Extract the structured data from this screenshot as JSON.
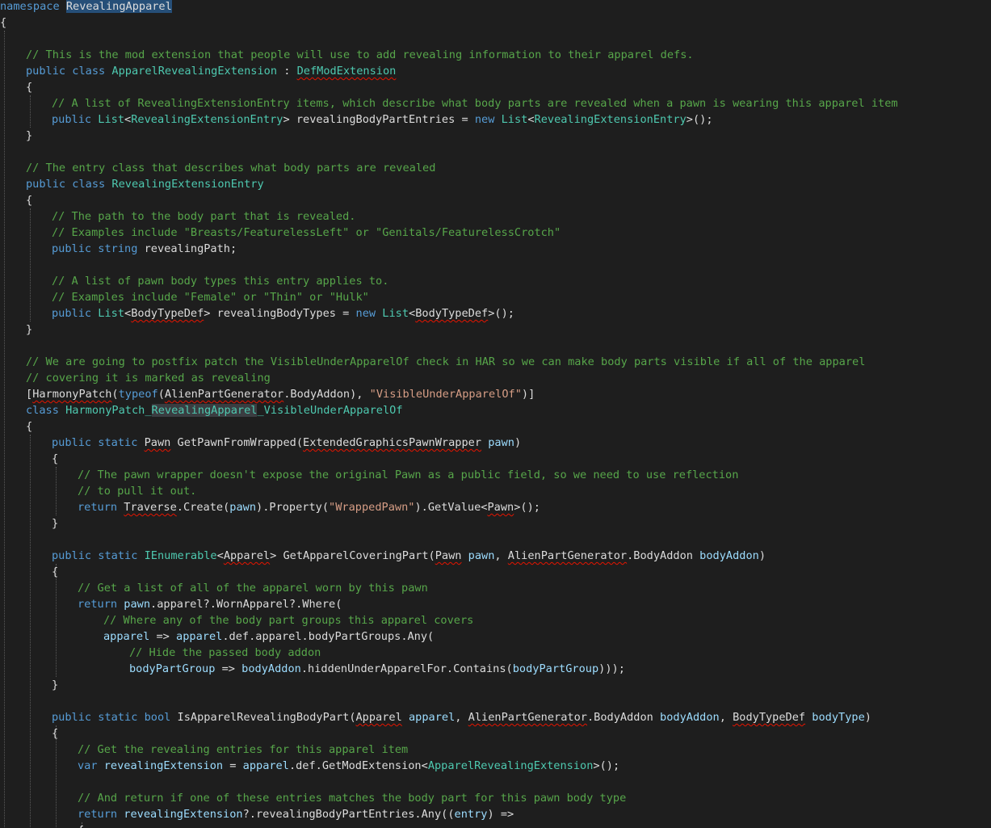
{
  "editor": {
    "file": "RevealingApparel",
    "colors": {
      "background": "#1e1e1e",
      "keyword": "#569cd6",
      "type": "#4ec9b0",
      "comment": "#57a64a",
      "string": "#d69d85",
      "parameter": "#9cdcfe",
      "plain": "#dcdcdc",
      "squiggle": "#e51400"
    },
    "lines": [
      [
        {
          "t": "namespace",
          "c": "kw"
        },
        {
          "t": " "
        },
        {
          "t": "RevealingApparel",
          "c": "pl hl"
        }
      ],
      [
        {
          "t": "{"
        }
      ],
      [],
      [
        {
          "t": "// This is the mod extension that people will use to add revealing information to their apparel defs.",
          "c": "cm"
        }
      ],
      [
        {
          "t": "public",
          "c": "kw"
        },
        {
          "t": " "
        },
        {
          "t": "class",
          "c": "kw"
        },
        {
          "t": " "
        },
        {
          "t": "ApparelRevealingExtension",
          "c": "ty"
        },
        {
          "t": " : "
        },
        {
          "t": "DefModExtension",
          "c": "ty sq"
        }
      ],
      [
        {
          "t": "{"
        }
      ],
      [
        {
          "t": "// A list of RevealingExtensionEntry items, which describe what body parts are revealed when a pawn is wearing this apparel item",
          "c": "cm"
        }
      ],
      [
        {
          "t": "public",
          "c": "kw"
        },
        {
          "t": " "
        },
        {
          "t": "List",
          "c": "ty"
        },
        {
          "t": "<"
        },
        {
          "t": "RevealingExtensionEntry",
          "c": "ty"
        },
        {
          "t": "> revealingBodyPartEntries = "
        },
        {
          "t": "new",
          "c": "kw"
        },
        {
          "t": " "
        },
        {
          "t": "List",
          "c": "ty"
        },
        {
          "t": "<"
        },
        {
          "t": "RevealingExtensionEntry",
          "c": "ty"
        },
        {
          "t": ">();"
        }
      ],
      [
        {
          "t": "}"
        }
      ],
      [],
      [
        {
          "t": "// The entry class that describes what body parts are revealed",
          "c": "cm"
        }
      ],
      [
        {
          "t": "public",
          "c": "kw"
        },
        {
          "t": " "
        },
        {
          "t": "class",
          "c": "kw"
        },
        {
          "t": " "
        },
        {
          "t": "RevealingExtensionEntry",
          "c": "ty"
        }
      ],
      [
        {
          "t": "{"
        }
      ],
      [
        {
          "t": "// The path to the body part that is revealed.",
          "c": "cm"
        }
      ],
      [
        {
          "t": "// Examples include \"Breasts/FeaturelessLeft\" or \"Genitals/FeaturelessCrotch\"",
          "c": "cm"
        }
      ],
      [
        {
          "t": "public",
          "c": "kw"
        },
        {
          "t": " "
        },
        {
          "t": "string",
          "c": "kw"
        },
        {
          "t": " revealingPath;"
        }
      ],
      [],
      [
        {
          "t": "// A list of pawn body types this entry applies to.",
          "c": "cm"
        }
      ],
      [
        {
          "t": "// Examples include \"Female\" or \"Thin\" or \"Hulk\"",
          "c": "cm"
        }
      ],
      [
        {
          "t": "public",
          "c": "kw"
        },
        {
          "t": " "
        },
        {
          "t": "List",
          "c": "ty"
        },
        {
          "t": "<"
        },
        {
          "t": "BodyTypeDef",
          "c": "pl sq"
        },
        {
          "t": "> revealingBodyTypes = "
        },
        {
          "t": "new",
          "c": "kw"
        },
        {
          "t": " "
        },
        {
          "t": "List",
          "c": "ty"
        },
        {
          "t": "<"
        },
        {
          "t": "BodyTypeDef",
          "c": "pl sq"
        },
        {
          "t": ">();"
        }
      ],
      [
        {
          "t": "}"
        }
      ],
      [],
      [
        {
          "t": "// We are going to postfix patch the VisibleUnderApparelOf check in HAR so we can make body parts visible if all of the apparel",
          "c": "cm"
        }
      ],
      [
        {
          "t": "// covering it is marked as revealing",
          "c": "cm"
        }
      ],
      [
        {
          "t": "["
        },
        {
          "t": "HarmonyPatch",
          "c": "pl sq"
        },
        {
          "t": "("
        },
        {
          "t": "typeof",
          "c": "kw"
        },
        {
          "t": "("
        },
        {
          "t": "AlienPartGenerator",
          "c": "pl sq"
        },
        {
          "t": "."
        },
        {
          "t": "BodyAddon",
          "c": "pl"
        },
        {
          "t": "), "
        },
        {
          "t": "\"VisibleUnderApparelOf\"",
          "c": "st"
        },
        {
          "t": ")]"
        }
      ],
      [
        {
          "t": "class",
          "c": "kw"
        },
        {
          "t": " "
        },
        {
          "t": "HarmonyPatch_",
          "c": "ty"
        },
        {
          "t": "RevealingApparel",
          "c": "ty hl2"
        },
        {
          "t": "_VisibleUnderApparelOf",
          "c": "ty"
        }
      ],
      [
        {
          "t": "{"
        }
      ],
      [
        {
          "t": "public",
          "c": "kw"
        },
        {
          "t": " "
        },
        {
          "t": "static",
          "c": "kw"
        },
        {
          "t": " "
        },
        {
          "t": "Pawn",
          "c": "pl sq"
        },
        {
          "t": " GetPawnFromWrapped("
        },
        {
          "t": "ExtendedGraphicsPawnWrapper",
          "c": "pl sq"
        },
        {
          "t": " "
        },
        {
          "t": "pawn",
          "c": "pa"
        },
        {
          "t": ")"
        }
      ],
      [
        {
          "t": "{"
        }
      ],
      [
        {
          "t": "// The pawn wrapper doesn't expose the original Pawn as a public field, so we need to use reflection",
          "c": "cm"
        }
      ],
      [
        {
          "t": "// to pull it out.",
          "c": "cm"
        }
      ],
      [
        {
          "t": "return",
          "c": "kw"
        },
        {
          "t": " "
        },
        {
          "t": "Traverse",
          "c": "pl sq"
        },
        {
          "t": ".Create("
        },
        {
          "t": "pawn",
          "c": "pa"
        },
        {
          "t": ").Property("
        },
        {
          "t": "\"WrappedPawn\"",
          "c": "st"
        },
        {
          "t": ").GetValue<"
        },
        {
          "t": "Pawn",
          "c": "pl sq"
        },
        {
          "t": ">();"
        }
      ],
      [
        {
          "t": "}"
        }
      ],
      [],
      [
        {
          "t": "public",
          "c": "kw"
        },
        {
          "t": " "
        },
        {
          "t": "static",
          "c": "kw"
        },
        {
          "t": " "
        },
        {
          "t": "IEnumerable",
          "c": "ty"
        },
        {
          "t": "<"
        },
        {
          "t": "Apparel",
          "c": "pl sq"
        },
        {
          "t": "> GetApparelCoveringPart("
        },
        {
          "t": "Pawn",
          "c": "pl sq"
        },
        {
          "t": " "
        },
        {
          "t": "pawn",
          "c": "pa"
        },
        {
          "t": ", "
        },
        {
          "t": "AlienPartGenerator",
          "c": "pl sq"
        },
        {
          "t": "."
        },
        {
          "t": "BodyAddon",
          "c": "pl"
        },
        {
          "t": " "
        },
        {
          "t": "bodyAddon",
          "c": "pa"
        },
        {
          "t": ")"
        }
      ],
      [
        {
          "t": "{"
        }
      ],
      [
        {
          "t": "// Get a list of all of the apparel worn by this pawn",
          "c": "cm"
        }
      ],
      [
        {
          "t": "return",
          "c": "kw"
        },
        {
          "t": " "
        },
        {
          "t": "pawn",
          "c": "pa"
        },
        {
          "t": ".apparel?.WornApparel?.Where("
        }
      ],
      [
        {
          "t": "// Where any of the body part groups this apparel covers",
          "c": "cm"
        }
      ],
      [
        {
          "t": "apparel",
          "c": "pa"
        },
        {
          "t": " => "
        },
        {
          "t": "apparel",
          "c": "pa"
        },
        {
          "t": ".def.apparel.bodyPartGroups.Any("
        }
      ],
      [
        {
          "t": "// Hide the passed body addon",
          "c": "cm"
        }
      ],
      [
        {
          "t": "bodyPartGroup",
          "c": "pa"
        },
        {
          "t": " => "
        },
        {
          "t": "bodyAddon",
          "c": "pa"
        },
        {
          "t": ".hiddenUnderApparelFor.Contains("
        },
        {
          "t": "bodyPartGroup",
          "c": "pa"
        },
        {
          "t": ")));"
        }
      ],
      [
        {
          "t": "}"
        }
      ],
      [],
      [
        {
          "t": "public",
          "c": "kw"
        },
        {
          "t": " "
        },
        {
          "t": "static",
          "c": "kw"
        },
        {
          "t": " "
        },
        {
          "t": "bool",
          "c": "kw"
        },
        {
          "t": " IsApparelRevealingBodyPart("
        },
        {
          "t": "Apparel",
          "c": "pl sq"
        },
        {
          "t": " "
        },
        {
          "t": "apparel",
          "c": "pa"
        },
        {
          "t": ", "
        },
        {
          "t": "AlienPartGenerator",
          "c": "pl sq"
        },
        {
          "t": "."
        },
        {
          "t": "BodyAddon",
          "c": "pl"
        },
        {
          "t": " "
        },
        {
          "t": "bodyAddon",
          "c": "pa"
        },
        {
          "t": ", "
        },
        {
          "t": "BodyTypeDef",
          "c": "pl sq"
        },
        {
          "t": " "
        },
        {
          "t": "bodyType",
          "c": "pa"
        },
        {
          "t": ")"
        }
      ],
      [
        {
          "t": "{"
        }
      ],
      [
        {
          "t": "// Get the revealing entries for this apparel item",
          "c": "cm"
        }
      ],
      [
        {
          "t": "var",
          "c": "kw"
        },
        {
          "t": " "
        },
        {
          "t": "revealingExtension",
          "c": "pa"
        },
        {
          "t": " = "
        },
        {
          "t": "apparel",
          "c": "pa"
        },
        {
          "t": ".def.GetModExtension<"
        },
        {
          "t": "ApparelRevealingExtension",
          "c": "ty"
        },
        {
          "t": ">();"
        }
      ],
      [],
      [
        {
          "t": "// And return if one of these entries matches the body part for this pawn body type",
          "c": "cm"
        }
      ],
      [
        {
          "t": "return",
          "c": "kw"
        },
        {
          "t": " "
        },
        {
          "t": "revealingExtension",
          "c": "pa"
        },
        {
          "t": "?.revealingBodyPartEntries.Any(("
        },
        {
          "t": "entry",
          "c": "pa"
        },
        {
          "t": ") =>"
        }
      ],
      [
        {
          "t": "{"
        }
      ]
    ]
  }
}
